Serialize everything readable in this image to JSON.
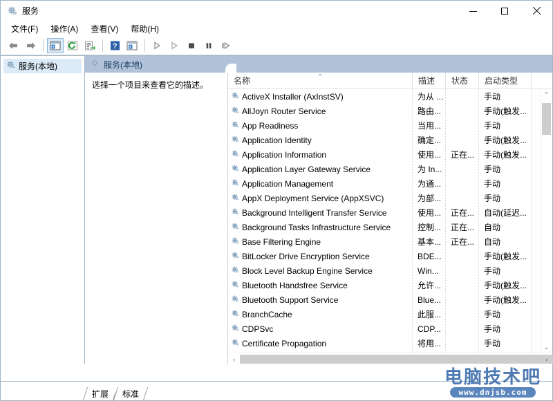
{
  "window": {
    "title": "服务",
    "icon": "services-gear-icon",
    "controls": {
      "minimize": "−",
      "maximize": "□",
      "close": "✕"
    }
  },
  "menubar": {
    "items": [
      {
        "label": "文件(F)",
        "name": "menu-file"
      },
      {
        "label": "操作(A)",
        "name": "menu-action"
      },
      {
        "label": "查看(V)",
        "name": "menu-view"
      },
      {
        "label": "帮助(H)",
        "name": "menu-help"
      }
    ]
  },
  "toolbar": {
    "buttons": [
      {
        "name": "back-button",
        "icon": "arrow-left-icon",
        "selected": false
      },
      {
        "name": "forward-button",
        "icon": "arrow-right-icon",
        "selected": false
      },
      {
        "name": "show-hide-console-tree-button",
        "icon": "console-tree-icon",
        "selected": true
      },
      {
        "name": "refresh-button",
        "icon": "refresh-icon",
        "selected": false
      },
      {
        "name": "export-list-button",
        "icon": "export-list-icon",
        "selected": false
      },
      {
        "name": "help-button",
        "icon": "help-icon",
        "selected": false
      },
      {
        "name": "properties-button",
        "icon": "properties-icon",
        "selected": false
      },
      {
        "name": "start-service-button",
        "icon": "play-icon",
        "selected": false
      },
      {
        "name": "restart-service-button",
        "icon": "play-outline-icon",
        "selected": false
      },
      {
        "name": "stop-service-button",
        "icon": "stop-icon",
        "selected": false
      },
      {
        "name": "pause-service-button",
        "icon": "pause-icon",
        "selected": false
      },
      {
        "name": "resume-service-button",
        "icon": "resume-icon",
        "selected": false
      }
    ]
  },
  "tree": {
    "root": {
      "label": "服务(本地)",
      "icon": "services-gear-icon",
      "selected": true
    }
  },
  "panel": {
    "header_title": "服务(本地)",
    "description": "选择一个项目来查看它的描述。"
  },
  "list": {
    "columns": [
      {
        "key": "name",
        "label": "名称",
        "sorted": true,
        "sort_dir": "asc"
      },
      {
        "key": "desc",
        "label": "描述",
        "sorted": false,
        "sort_dir": ""
      },
      {
        "key": "state",
        "label": "状态",
        "sorted": false,
        "sort_dir": ""
      },
      {
        "key": "start",
        "label": "启动类型",
        "sorted": false,
        "sort_dir": ""
      },
      {
        "key": "logon",
        "label": "",
        "sorted": false,
        "sort_dir": ""
      }
    ],
    "sort_indicator": "^",
    "rows": [
      {
        "name": "ActiveX Installer (AxInstSV)",
        "desc": "为从 ...",
        "state": "",
        "start": "手动"
      },
      {
        "name": "AllJoyn Router Service",
        "desc": "路由...",
        "state": "",
        "start": "手动(触发..."
      },
      {
        "name": "App Readiness",
        "desc": "当用...",
        "state": "",
        "start": "手动"
      },
      {
        "name": "Application Identity",
        "desc": "确定...",
        "state": "",
        "start": "手动(触发..."
      },
      {
        "name": "Application Information",
        "desc": "使用...",
        "state": "正在...",
        "start": "手动(触发..."
      },
      {
        "name": "Application Layer Gateway Service",
        "desc": "为 In...",
        "state": "",
        "start": "手动"
      },
      {
        "name": "Application Management",
        "desc": "为通...",
        "state": "",
        "start": "手动"
      },
      {
        "name": "AppX Deployment Service (AppXSVC)",
        "desc": "为部...",
        "state": "",
        "start": "手动"
      },
      {
        "name": "Background Intelligent Transfer Service",
        "desc": "使用...",
        "state": "正在...",
        "start": "自动(延迟..."
      },
      {
        "name": "Background Tasks Infrastructure Service",
        "desc": "控制...",
        "state": "正在...",
        "start": "自动"
      },
      {
        "name": "Base Filtering Engine",
        "desc": "基本...",
        "state": "正在...",
        "start": "自动"
      },
      {
        "name": "BitLocker Drive Encryption Service",
        "desc": "BDE...",
        "state": "",
        "start": "手动(触发..."
      },
      {
        "name": "Block Level Backup Engine Service",
        "desc": "Win...",
        "state": "",
        "start": "手动"
      },
      {
        "name": "Bluetooth Handsfree Service",
        "desc": "允许...",
        "state": "",
        "start": "手动(触发..."
      },
      {
        "name": "Bluetooth Support Service",
        "desc": "Blue...",
        "state": "",
        "start": "手动(触发..."
      },
      {
        "name": "BranchCache",
        "desc": "此服...",
        "state": "",
        "start": "手动"
      },
      {
        "name": "CDPSvc",
        "desc": "CDP...",
        "state": "",
        "start": "手动"
      },
      {
        "name": "Certificate Propagation",
        "desc": "将用...",
        "state": "",
        "start": "手动"
      }
    ]
  },
  "scrollbars": {
    "vertical": {
      "up_arrow": "⌃",
      "down_arrow": "⌄"
    },
    "horizontal": {
      "left_arrow": "‹",
      "right_arrow": "›"
    }
  },
  "tabs": [
    {
      "label": "扩展",
      "name": "tab-extended",
      "active": false
    },
    {
      "label": "标准",
      "name": "tab-standard",
      "active": true
    }
  ],
  "watermark": {
    "text": "电脑技术吧",
    "url": "www.dnjsb.com"
  },
  "colors": {
    "header_band": "#b2c3d9",
    "selection": "#dcebf7",
    "window_border": "#9fb6c8",
    "watermark": "#3f6fad"
  }
}
